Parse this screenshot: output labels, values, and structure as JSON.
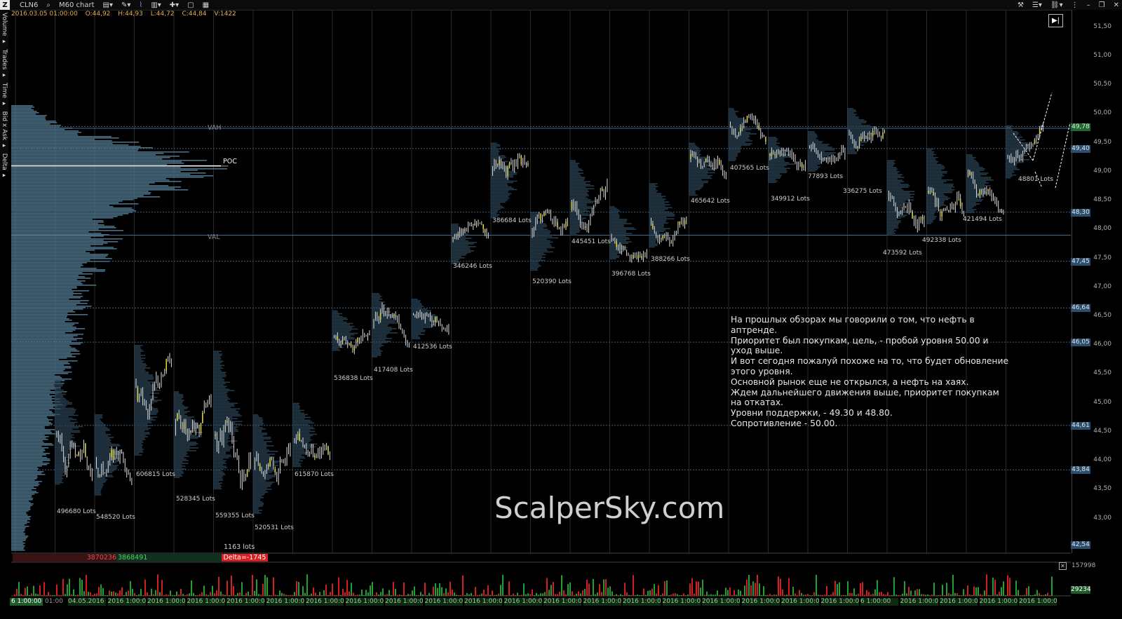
{
  "toolbar": {
    "logo": "Z",
    "symbol": "CLN6",
    "chart_type": "M60 chart",
    "right_controls": [
      "✕",
      "▭",
      "⧉",
      "▢"
    ]
  },
  "side_panels": [
    "Volume ▸",
    "Trades ▸",
    "Time ▸",
    "Bid x Ask ▸",
    "Delta ▸"
  ],
  "ohlc": {
    "date": "2016.03.05 01:00:00",
    "open": "O:44,92",
    "high": "H:44,93",
    "low": "L:44,72",
    "close": "C:44,84",
    "volume": "V:1422"
  },
  "labels": {
    "vah": "VAH",
    "poc": "POC",
    "val": "VAL",
    "total_lots": "1163 lots"
  },
  "price_axis": [
    "51,50",
    "51,00",
    "50,50",
    "50,00",
    "49,50",
    "49,00",
    "48,50",
    "48,00",
    "47,50",
    "47,00",
    "46,50",
    "46,00",
    "45,50",
    "45,00",
    "44,50",
    "44,00",
    "43,50",
    "43,00"
  ],
  "price_tags": [
    {
      "text": "49,78",
      "price": 49.78,
      "color": "#1e6a2e"
    },
    {
      "text": "49,40",
      "price": 49.4,
      "color": "#2b4d6e"
    },
    {
      "text": "48,30",
      "price": 48.3,
      "color": "#2b4d6e"
    },
    {
      "text": "47,45",
      "price": 47.45,
      "color": "#2b4d6e"
    },
    {
      "text": "46,64",
      "price": 46.64,
      "color": "#2b4d6e"
    },
    {
      "text": "46,05",
      "price": 46.05,
      "color": "#2b4d6e"
    },
    {
      "text": "44,61",
      "price": 44.61,
      "color": "#2b4d6e"
    },
    {
      "text": "43,84",
      "price": 43.84,
      "color": "#2b4d6e"
    },
    {
      "text": "42,54",
      "price": 42.54,
      "color": "#2b4d6e"
    }
  ],
  "lot_labels": [
    {
      "text": "496680 Lots",
      "x": 81,
      "y": 725
    },
    {
      "text": "548520 Lots",
      "x": 137,
      "y": 733
    },
    {
      "text": "606815 Lots",
      "x": 194,
      "y": 672
    },
    {
      "text": "528345 Lots",
      "x": 251,
      "y": 707
    },
    {
      "text": "559355 Lots",
      "x": 307,
      "y": 731
    },
    {
      "text": "520531 Lots",
      "x": 363,
      "y": 748
    },
    {
      "text": "615870 Lots",
      "x": 420,
      "y": 672
    },
    {
      "text": "536838 Lots",
      "x": 476,
      "y": 535
    },
    {
      "text": "417408 Lots",
      "x": 533,
      "y": 523
    },
    {
      "text": "412536 Lots",
      "x": 589,
      "y": 490
    },
    {
      "text": "346246 Lots",
      "x": 646,
      "y": 375
    },
    {
      "text": "386684 Lots",
      "x": 702,
      "y": 310
    },
    {
      "text": "520390 Lots",
      "x": 759,
      "y": 397
    },
    {
      "text": "445451 Lots",
      "x": 815,
      "y": 340
    },
    {
      "text": "396768 Lots",
      "x": 872,
      "y": 386
    },
    {
      "text": "388266 Lots",
      "x": 928,
      "y": 365
    },
    {
      "text": "465642 Lots",
      "x": 985,
      "y": 282
    },
    {
      "text": "407565 Lots",
      "x": 1041,
      "y": 235
    },
    {
      "text": "349912 Lots",
      "x": 1099,
      "y": 279
    },
    {
      "text": "77893 Lots",
      "x": 1152,
      "y": 247
    },
    {
      "text": "336275 Lots",
      "x": 1202,
      "y": 268
    },
    {
      "text": "473592 Lots",
      "x": 1259,
      "y": 356
    },
    {
      "text": "492338 Lots",
      "x": 1315,
      "y": 338
    },
    {
      "text": "421494 Lots",
      "x": 1373,
      "y": 308
    },
    {
      "text": "48801 Lots",
      "x": 1452,
      "y": 251
    }
  ],
  "annotation": [
    "На прошлых обзорах мы говорили о том, что нефть в",
    "аптренде.",
    "Приоритет был покупкам, цель, - пробой уровня 50.00 и",
    "уход выше.",
    "И вот сегодня пожалуй похоже на то, что будет обновление",
    "этого уровня.",
    "Основной рынок еще не открылся, а нефть на хаях.",
    "Ждем дальнейшего движения выше, приоритет покупкам",
    "на откатах.",
    "Уровни поддержки, - 49.30 и 48.80.",
    "Сопротивление - 50.00."
  ],
  "watermark": "ScalperSky.com",
  "delta_bar": {
    "sell": "3870236",
    "buy": "3868491",
    "delta": "Delta=-1745"
  },
  "volume_axis": {
    "top": "157998",
    "current": "29234"
  },
  "time_axis": {
    "current": "6 1:00:00",
    "first": "01:00",
    "labels": [
      "04.05.2016 1:00:00",
      "2016 1:00:00",
      "2016 1:00:00",
      "2016 1:00:00",
      "2016 1:00:00",
      "2016 1:00:00",
      "2016 1:00:00",
      "2016 1:00:00",
      "2016 1:00:00",
      "2016 1:00:00",
      "2016 1:00:00",
      "2016 1:00:00",
      "2016 1:00:00",
      "2016 1:00:00",
      "2016 1:00:00",
      "2016 1:00:00",
      "2016 1:00:00",
      "2016 1:00:00",
      "2016 1:00:00",
      "2016 1:00:00",
      "6 1:00:00",
      "2016 1:00:00",
      "2016 1:00:00",
      "2016 1:00:00",
      "2016 1:00:00"
    ]
  },
  "chart_data": {
    "type": "candlestick",
    "symbol": "CLN6",
    "timeframe": "M60",
    "ylim": [
      42.4,
      51.8
    ],
    "levels": {
      "vah": 49.75,
      "poc": 49.1,
      "val": 47.9
    },
    "horizontal_levels": [
      49.78,
      49.4,
      48.3,
      47.45,
      46.64,
      46.05,
      44.61,
      43.84
    ],
    "sessions": [
      {
        "volume_lots": 496680,
        "low": 43.6,
        "high": 45.4
      },
      {
        "volume_lots": 548520,
        "low": 43.4,
        "high": 44.8
      },
      {
        "volume_lots": 606815,
        "low": 44.1,
        "high": 46.0
      },
      {
        "volume_lots": 528345,
        "low": 43.7,
        "high": 45.2
      },
      {
        "volume_lots": 559355,
        "low": 43.5,
        "high": 45.9
      },
      {
        "volume_lots": 520531,
        "low": 43.1,
        "high": 44.8
      },
      {
        "volume_lots": 615870,
        "low": 43.9,
        "high": 45.0
      },
      {
        "volume_lots": 536838,
        "low": 45.9,
        "high": 46.6
      },
      {
        "volume_lots": 417408,
        "low": 45.8,
        "high": 46.9
      },
      {
        "volume_lots": 412536,
        "low": 46.1,
        "high": 46.8
      },
      {
        "volume_lots": 346246,
        "low": 47.4,
        "high": 48.1
      },
      {
        "volume_lots": 386684,
        "low": 48.2,
        "high": 49.5
      },
      {
        "volume_lots": 520390,
        "low": 47.3,
        "high": 48.3
      },
      {
        "volume_lots": 445451,
        "low": 47.9,
        "high": 49.2
      },
      {
        "volume_lots": 396768,
        "low": 47.5,
        "high": 48.4
      },
      {
        "volume_lots": 388266,
        "low": 47.7,
        "high": 48.8
      },
      {
        "volume_lots": 465642,
        "low": 48.6,
        "high": 49.5
      },
      {
        "volume_lots": 407565,
        "low": 49.2,
        "high": 50.1
      },
      {
        "volume_lots": 349912,
        "low": 48.8,
        "high": 49.6
      },
      {
        "volume_lots": 77893,
        "low": 49.0,
        "high": 49.7
      },
      {
        "volume_lots": 336275,
        "low": 49.3,
        "high": 50.1
      },
      {
        "volume_lots": 473592,
        "low": 47.9,
        "high": 49.2
      },
      {
        "volume_lots": 492338,
        "low": 48.1,
        "high": 49.4
      },
      {
        "volume_lots": 421494,
        "low": 48.3,
        "high": 49.3
      },
      {
        "volume_lots": 48801,
        "low": 48.9,
        "high": 49.8
      }
    ]
  }
}
